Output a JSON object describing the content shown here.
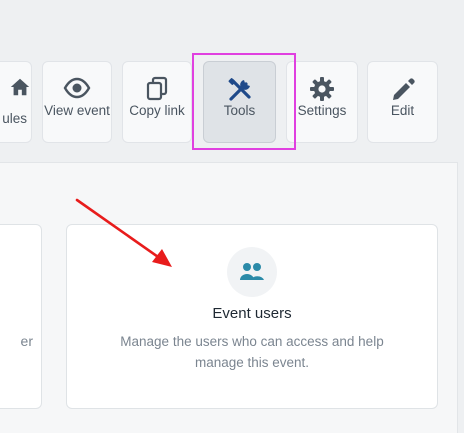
{
  "toolbar": {
    "buttons": [
      {
        "label": "ules",
        "icon": "home-icon"
      },
      {
        "label": "View event",
        "icon": "eye-icon"
      },
      {
        "label": "Copy link",
        "icon": "copy-icon"
      },
      {
        "label": "Tools",
        "icon": "tools-icon",
        "active": true
      },
      {
        "label": "Settings",
        "icon": "gear-icon"
      },
      {
        "label": "Edit",
        "icon": "pencil-icon"
      }
    ]
  },
  "cards": {
    "left_fragment": "er",
    "event_users": {
      "title": "Event users",
      "description": "Manage the users who can access and help manage this event.",
      "icon": "users-icon",
      "icon_color": "#2b8aa8"
    }
  },
  "colors": {
    "highlight": "#e040e0",
    "annotation_arrow": "#e81c1c",
    "icon_gray": "#4a5560"
  }
}
